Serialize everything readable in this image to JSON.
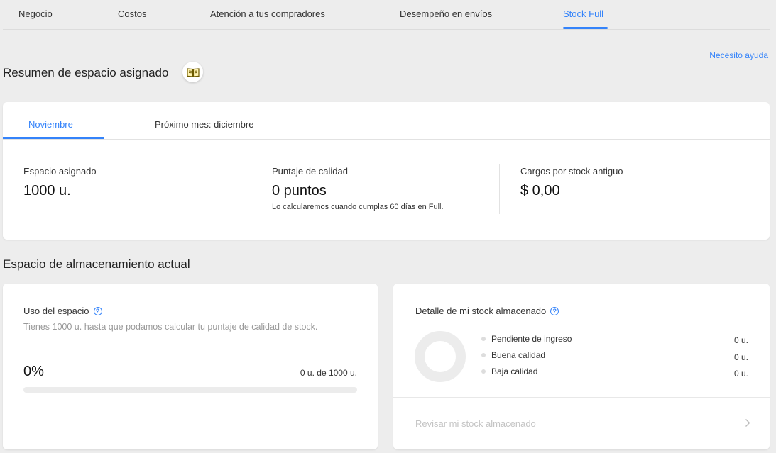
{
  "nav": {
    "tabs": [
      "Negocio",
      "Costos",
      "Atención a tus compradores",
      "Desempeño en envíos",
      "Stock Full"
    ],
    "active": "Stock Full"
  },
  "help_link": "Necesito ayuda",
  "summary": {
    "title": "Resumen de espacio asignado",
    "icon": "book-icon",
    "tabs": [
      "Noviembre",
      "Próximo mes: diciembre"
    ],
    "metrics": [
      {
        "label": "Espacio asignado",
        "value": "1000 u."
      },
      {
        "label": "Puntaje de calidad",
        "value": "0 puntos",
        "note": "Lo calcularemos cuando cumplas 60 días en Full."
      },
      {
        "label": "Cargos por stock antiguo",
        "value": "$ 0,00"
      }
    ]
  },
  "storage": {
    "title": "Espacio de almacenamiento actual",
    "usage": {
      "heading": "Uso del espacio",
      "description": "Tienes 1000 u. hasta que podamos calcular tu puntaje de calidad de stock.",
      "percent_label": "0%",
      "ratio": "0 u. de 1000 u.",
      "fill_fraction": 0
    },
    "detail": {
      "heading": "Detalle de mi stock almacenado",
      "legend": [
        {
          "label": "Pendiente de ingreso",
          "value": "0 u."
        },
        {
          "label": "Buena calidad",
          "value": "0 u."
        },
        {
          "label": "Baja calidad",
          "value": "0 u."
        }
      ],
      "link": "Revisar mi stock almacenado"
    }
  },
  "colors": {
    "accent": "#3483fa",
    "background": "#ededed"
  }
}
